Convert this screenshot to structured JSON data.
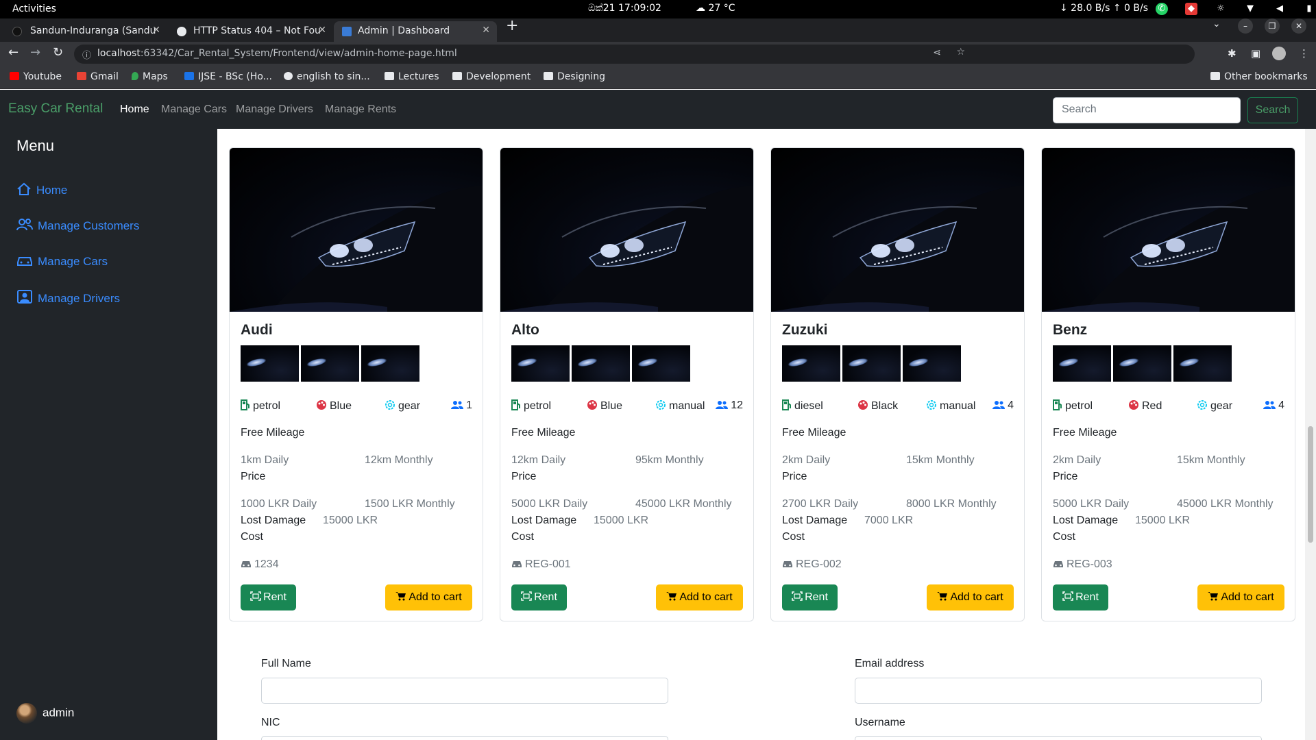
{
  "os_bar": {
    "activities": "Activities",
    "clock": "ඔක්21  17:09:02",
    "weather": "27 °C",
    "network": "↓ 28.0 B/s  ↑ 0 B/s"
  },
  "browser": {
    "tabs": [
      {
        "title": "Sandun-Induranga (Sandu",
        "active": false
      },
      {
        "title": "HTTP Status 404 – Not Fou",
        "active": false
      },
      {
        "title": "Admin | Dashboard",
        "active": true
      }
    ],
    "url_host": "localhost",
    "url_rest": ":63342/Car_Rental_System/Frontend/view/admin-home-page.html",
    "bookmarks": [
      "Youtube",
      "Gmail",
      "Maps",
      "IJSE - BSc (Ho...",
      "english to sin...",
      "Lectures",
      "Development",
      "Designing"
    ],
    "other_bookmarks": "Other bookmarks"
  },
  "navbar": {
    "brand": "Easy Car Rental",
    "links": [
      "Home",
      "Manage Cars",
      "Manage Drivers",
      "Manage Rents"
    ],
    "search_placeholder": "Search",
    "search_button": "Search"
  },
  "sidebar": {
    "title": "Menu",
    "items": [
      "Home",
      "Manage Customers",
      "Manage Cars",
      "Manage Drivers"
    ],
    "user": "admin"
  },
  "labels": {
    "free_mileage": "Free Mileage",
    "price": "Price",
    "lost_damage_1": "Lost Damage",
    "lost_damage_2": "Cost",
    "rent": "Rent",
    "add_to_cart": "Add to cart"
  },
  "cars": [
    {
      "name": "Audi",
      "fuel": "petrol",
      "color": "Blue",
      "transmission": "gear",
      "passengers": "1",
      "mileage_daily": "1km Daily",
      "mileage_monthly": "12km Monthly",
      "price_daily": "1000 LKR Daily",
      "price_monthly": "1500 LKR Monthly",
      "damage": "15000 LKR",
      "reg": "1234",
      "color_hex": "#dc3545"
    },
    {
      "name": "Alto",
      "fuel": "petrol",
      "color": "Blue",
      "transmission": "manual",
      "passengers": "12",
      "mileage_daily": "12km Daily",
      "mileage_monthly": "95km Monthly",
      "price_daily": "5000 LKR Daily",
      "price_monthly": "45000 LKR Monthly",
      "damage": "15000 LKR",
      "reg": "REG-001",
      "color_hex": "#dc3545"
    },
    {
      "name": "Zuzuki",
      "fuel": "diesel",
      "color": "Black",
      "transmission": "manual",
      "passengers": "4",
      "mileage_daily": "2km Daily",
      "mileage_monthly": "15km Monthly",
      "price_daily": "2700 LKR Daily",
      "price_monthly": "8000 LKR Monthly",
      "damage": "7000 LKR",
      "reg": "REG-002",
      "color_hex": "#dc3545"
    },
    {
      "name": "Benz",
      "fuel": "petrol",
      "color": "Red",
      "transmission": "gear",
      "passengers": "4",
      "mileage_daily": "2km Daily",
      "mileage_monthly": "15km Monthly",
      "price_daily": "5000 LKR Daily",
      "price_monthly": "45000 LKR Monthly",
      "damage": "15000 LKR",
      "reg": "REG-003",
      "color_hex": "#dc3545"
    }
  ],
  "form": {
    "full_name": "Full Name",
    "email": "Email address",
    "nic": "NIC",
    "username": "Username"
  },
  "colors": {
    "brand_green": "#4a9e68",
    "sidebar_link": "#3a8cff",
    "rent_button": "#198754",
    "cart_button": "#ffc107"
  }
}
